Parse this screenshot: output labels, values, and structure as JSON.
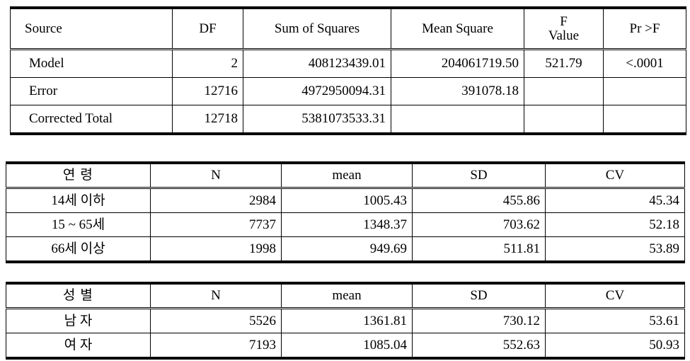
{
  "document": {
    "title": "ANOVA and descriptive statistics tables"
  },
  "anova_table": {
    "name": "analysis-of-variance",
    "columns": [
      {
        "key": "source",
        "label": "Source",
        "align": "left"
      },
      {
        "key": "df",
        "label": "DF",
        "align": "center"
      },
      {
        "key": "ss",
        "label": "Sum of Squares",
        "align": "center"
      },
      {
        "key": "ms",
        "label": "Mean Square",
        "align": "center"
      },
      {
        "key": "f_line1",
        "label": "F",
        "align": "center"
      },
      {
        "key": "f_line2",
        "label": "Value",
        "align": "center"
      },
      {
        "key": "pr",
        "label": "Pr >F",
        "align": "center"
      }
    ],
    "header": {
      "source": "Source",
      "df": "DF",
      "sum_of_squares": "Sum of Squares",
      "mean_square": "Mean Square",
      "f_value_line1": "F",
      "f_value_line2": "Value",
      "pr_f": "Pr >F"
    },
    "rows": [
      {
        "source": "Model",
        "df": "2",
        "sum_of_squares": "408123439.01",
        "mean_square": "204061719.50",
        "f_value": "521.79",
        "pr_f": "<.0001"
      },
      {
        "source": "Error",
        "df": "12716",
        "sum_of_squares": "4972950094.31",
        "mean_square": "391078.18",
        "f_value": "",
        "pr_f": ""
      },
      {
        "source": "Corrected  Total",
        "df": "12718",
        "sum_of_squares": "5381073533.31",
        "mean_square": "",
        "f_value": "",
        "pr_f": ""
      }
    ]
  },
  "age_table": {
    "name": "age-group-statistics",
    "header": {
      "group": "연  령",
      "n": "N",
      "mean": "mean",
      "sd": "SD",
      "cv": "CV"
    },
    "rows": [
      {
        "group": "14세 이하",
        "n": "2984",
        "mean": "1005.43",
        "sd": "455.86",
        "cv": "45.34"
      },
      {
        "group": "15 ~ 65세",
        "n": "7737",
        "mean": "1348.37",
        "sd": "703.62",
        "cv": "52.18"
      },
      {
        "group": "66세 이상",
        "n": "1998",
        "mean": "949.69",
        "sd": "511.81",
        "cv": "53.89"
      }
    ]
  },
  "sex_table": {
    "name": "sex-group-statistics",
    "header": {
      "group": "성  별",
      "n": "N",
      "mean": "mean",
      "sd": "SD",
      "cv": "CV"
    },
    "rows": [
      {
        "group": "남  자",
        "n": "5526",
        "mean": "1361.81",
        "sd": "730.12",
        "cv": "53.61"
      },
      {
        "group": "여  자",
        "n": "7193",
        "mean": "1085.04",
        "sd": "552.63",
        "cv": "50.93"
      }
    ]
  },
  "colors": {
    "rule": "#000000",
    "background": "#ffffff",
    "text": "#000000"
  }
}
